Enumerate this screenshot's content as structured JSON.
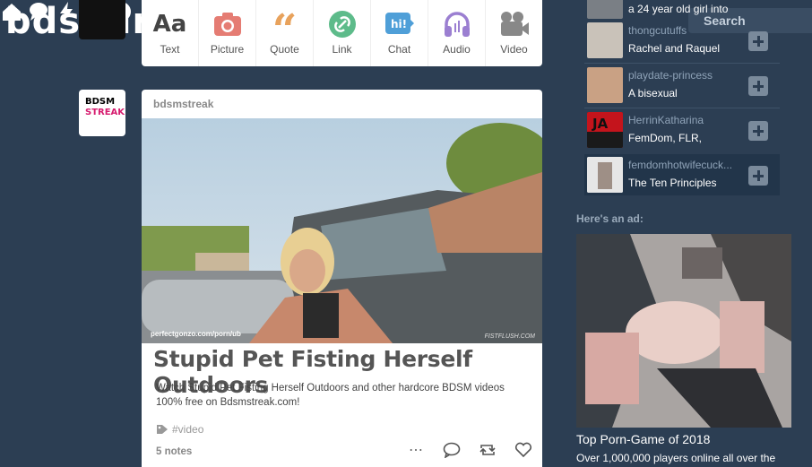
{
  "header": {
    "logo": "bdsmlr",
    "search_label": "Search",
    "icons": [
      "home-icon",
      "chat-bubble-icon",
      "lightning-icon",
      "user-icon",
      "help-icon"
    ]
  },
  "post_types": [
    {
      "label": "Text",
      "icon": "text-icon",
      "color": "#444444"
    },
    {
      "label": "Picture",
      "icon": "camera-icon",
      "color": "#e57c73"
    },
    {
      "label": "Quote",
      "icon": "quote-icon",
      "color": "#e8a25c"
    },
    {
      "label": "Link",
      "icon": "link-icon",
      "color": "#5dbb8a"
    },
    {
      "label": "Chat",
      "icon": "chat-icon",
      "color": "#4f9fd8"
    },
    {
      "label": "Audio",
      "icon": "headphones-icon",
      "color": "#9b7fd1"
    },
    {
      "label": "Video",
      "icon": "video-camera-icon",
      "color": "#8a8a8a"
    }
  ],
  "post": {
    "avatar_line1": "BDSM",
    "avatar_line2": "STREAK",
    "author": "bdsmstreak",
    "media_watermark_left": "perfectgonzo.com/porn/ub",
    "media_watermark_right": "FISTFLUSH.COM",
    "title": "Stupid Pet Fisting Herself Outdoors",
    "body": "Watch Stupid Pet Fisting Herself Outdoors and other hardcore BDSM videos 100% free on Bdsmstreak.com!",
    "tag": "#video",
    "notes": "5 notes"
  },
  "recommended": [
    {
      "name": "",
      "desc": "a 24 year old girl into",
      "thumb": "#7a7f85"
    },
    {
      "name": "thongcutuffs",
      "desc": "Rachel and Raquel",
      "thumb": "#c9c2b9"
    },
    {
      "name": "playdate-princess",
      "desc": "A bisexual",
      "thumb": "#c9a184"
    },
    {
      "name": "HerrinKatharina",
      "desc": "FemDom, FLR,",
      "thumb": "#c4141c"
    },
    {
      "name": "femdomhotwifecuck...",
      "desc": "The Ten Principles",
      "thumb": "#e6e6e6"
    }
  ],
  "ad": {
    "heading": "Here's an ad:",
    "title": "Top Porn-Game of 2018",
    "subtitle": "Over 1,000,000 players online all over the"
  },
  "colors": {
    "background": "#2c3e53",
    "card": "#ffffff",
    "accent_pink": "#d61b6e"
  }
}
